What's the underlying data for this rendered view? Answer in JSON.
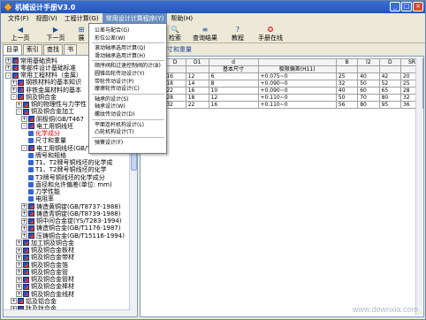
{
  "window": {
    "title": "机械设计手册V3.0"
  },
  "window_buttons": [
    "_",
    "□",
    "×"
  ],
  "menubar": [
    "文件(F)",
    "视图(V)",
    "工程计算(G)",
    "常用设计计算程序(Y)",
    "帮助(H)"
  ],
  "toolbar": [
    {
      "label": "上一页",
      "icon": "arrow-left-icon",
      "glyph": "◀"
    },
    {
      "label": "下一页",
      "icon": "arrow-right-icon",
      "glyph": "▶"
    },
    {
      "label": "展",
      "icon": "expand-icon",
      "glyph": "⊞"
    },
    {
      "label": "检索",
      "icon": "search-icon",
      "glyph": "🔍"
    },
    {
      "label": "查询结果",
      "icon": "results-icon",
      "glyph": "≡"
    },
    {
      "label": "教程",
      "icon": "tutorial-icon",
      "glyph": "?"
    },
    {
      "label": "手册在线",
      "icon": "online-icon",
      "glyph": "✪"
    }
  ],
  "tabs": [
    "目录",
    "索引",
    "查找",
    "书"
  ],
  "tree": [
    {
      "label": "常用基础资料",
      "exp": "+",
      "icon": "book"
    },
    {
      "label": "零部件设计基础标准",
      "exp": "+",
      "icon": "book"
    },
    {
      "label": "常用工程材料（金属）",
      "exp": "-",
      "icon": "book"
    },
    {
      "label": "钢铁材料的基本知识",
      "exp": "+",
      "icon": "book"
    },
    {
      "label": "非铁金属材料的基本",
      "exp": "+",
      "icon": "book"
    },
    {
      "label": "铜及铜合金",
      "exp": "-",
      "icon": "book"
    },
    {
      "label": "铜的物理性与力学性",
      "exp": "+",
      "icon": "book"
    },
    {
      "label": "铜及铜合金加工",
      "exp": "-",
      "icon": "book"
    },
    {
      "label": "阴极铜(GB/T467",
      "exp": "+",
      "icon": "book"
    },
    {
      "label": "电工用铜线坯",
      "exp": "-",
      "icon": "book"
    },
    {
      "label": "化学成分",
      "exp": "",
      "icon": "leaf",
      "hl": true
    },
    {
      "label": "尺寸和重量",
      "exp": "",
      "icon": "leaf"
    },
    {
      "label": "电工用铜线坯(GB/T3952-1998)",
      "exp": "-",
      "icon": "book"
    },
    {
      "label": "牌号和规格",
      "exp": "",
      "icon": "leaf"
    },
    {
      "label": "T1、T2牌号铜线坯的化学成",
      "exp": "",
      "icon": "leaf"
    },
    {
      "label": "T1、T2牌号铜线坯的化学",
      "exp": "",
      "icon": "leaf"
    },
    {
      "label": "T3牌号铜线坯的化学成分",
      "exp": "",
      "icon": "leaf"
    },
    {
      "label": "直径和允许偏差(单位: mm)",
      "exp": "",
      "icon": "leaf"
    },
    {
      "label": "力学性能",
      "exp": "",
      "icon": "leaf"
    },
    {
      "label": "电阻率",
      "exp": "",
      "icon": "leaf"
    },
    {
      "label": "铸造黄铜锭(GB/T8737-1988)",
      "exp": "+",
      "icon": "book"
    },
    {
      "label": "铸造青铜锭(GB/T8739-1988)",
      "exp": "+",
      "icon": "book"
    },
    {
      "label": "铜中间合金锭(YS/T283-1994)",
      "exp": "+",
      "icon": "book"
    },
    {
      "label": "铸造铜合金(GB/T1176-1987)",
      "exp": "+",
      "icon": "book"
    },
    {
      "label": "压铸铜合金(GB/T15116-1994)",
      "exp": "+",
      "icon": "book"
    },
    {
      "label": "加工铜及铜合金",
      "exp": "+",
      "icon": "book"
    },
    {
      "label": "铜及铜合金板材",
      "exp": "+",
      "icon": "book"
    },
    {
      "label": "铜及铜合金带材",
      "exp": "+",
      "icon": "book"
    },
    {
      "label": "铜及铜合金箔",
      "exp": "+",
      "icon": "book"
    },
    {
      "label": "铜及铜合金管",
      "exp": "+",
      "icon": "book"
    },
    {
      "label": "铜及铜合金管材",
      "exp": "+",
      "icon": "book"
    },
    {
      "label": "铜及铜合金棒材",
      "exp": "+",
      "icon": "book"
    },
    {
      "label": "铜及铜合金线材",
      "exp": "+",
      "icon": "book"
    },
    {
      "label": "铝及铝合金",
      "exp": "+",
      "icon": "book"
    },
    {
      "label": "钛及钛合金",
      "exp": "+",
      "icon": "book"
    }
  ],
  "right_head": "尺寸和重量",
  "table": {
    "header_row1": [
      "",
      "D",
      "D1",
      "d",
      "",
      "B",
      "l2",
      "D",
      "SR"
    ],
    "header_row2": [
      "",
      "",
      "",
      "基本尺寸",
      "极限偏差(H11)",
      "",
      "",
      "",
      ""
    ],
    "rows": [
      [
        "32",
        "16",
        "12",
        "6",
        "+0.075~0",
        "25",
        "40",
        "42",
        "20"
      ],
      [
        "40",
        "18",
        "14",
        "8",
        "+0.090~0",
        "32",
        "50",
        "52",
        "25"
      ],
      [
        "40",
        "22",
        "16",
        "10",
        "+0.090~0",
        "40",
        "60",
        "65",
        "28"
      ],
      [
        "50",
        "28",
        "18",
        "12",
        "+0.110~0",
        "50",
        "70",
        "80",
        "32"
      ],
      [
        "56",
        "32",
        "22",
        "16",
        "+0.110~0",
        "56",
        "80",
        "95",
        "36"
      ]
    ]
  },
  "dropdown": [
    "公差与配合(G)",
    "形位公差(W)",
    "---",
    "滚动轴承选用计算(Q)",
    "滑动轴承选用计算(H)",
    "---",
    "顺序阀和过速控制阀的计(B)",
    "圆锥齿轮传动设计(Y)",
    "带轮传动设计(P)",
    "摩擦轮传动设计(C)",
    "---",
    "轴承的设计(S)",
    "轴承设计(W)",
    "螺纹传动设计(D)",
    "---",
    "平面连杆机构设计(L)",
    "凸轮机构设计(T)",
    "---",
    "弹簧设计(F)"
  ],
  "watermark": "www.downxia.com"
}
